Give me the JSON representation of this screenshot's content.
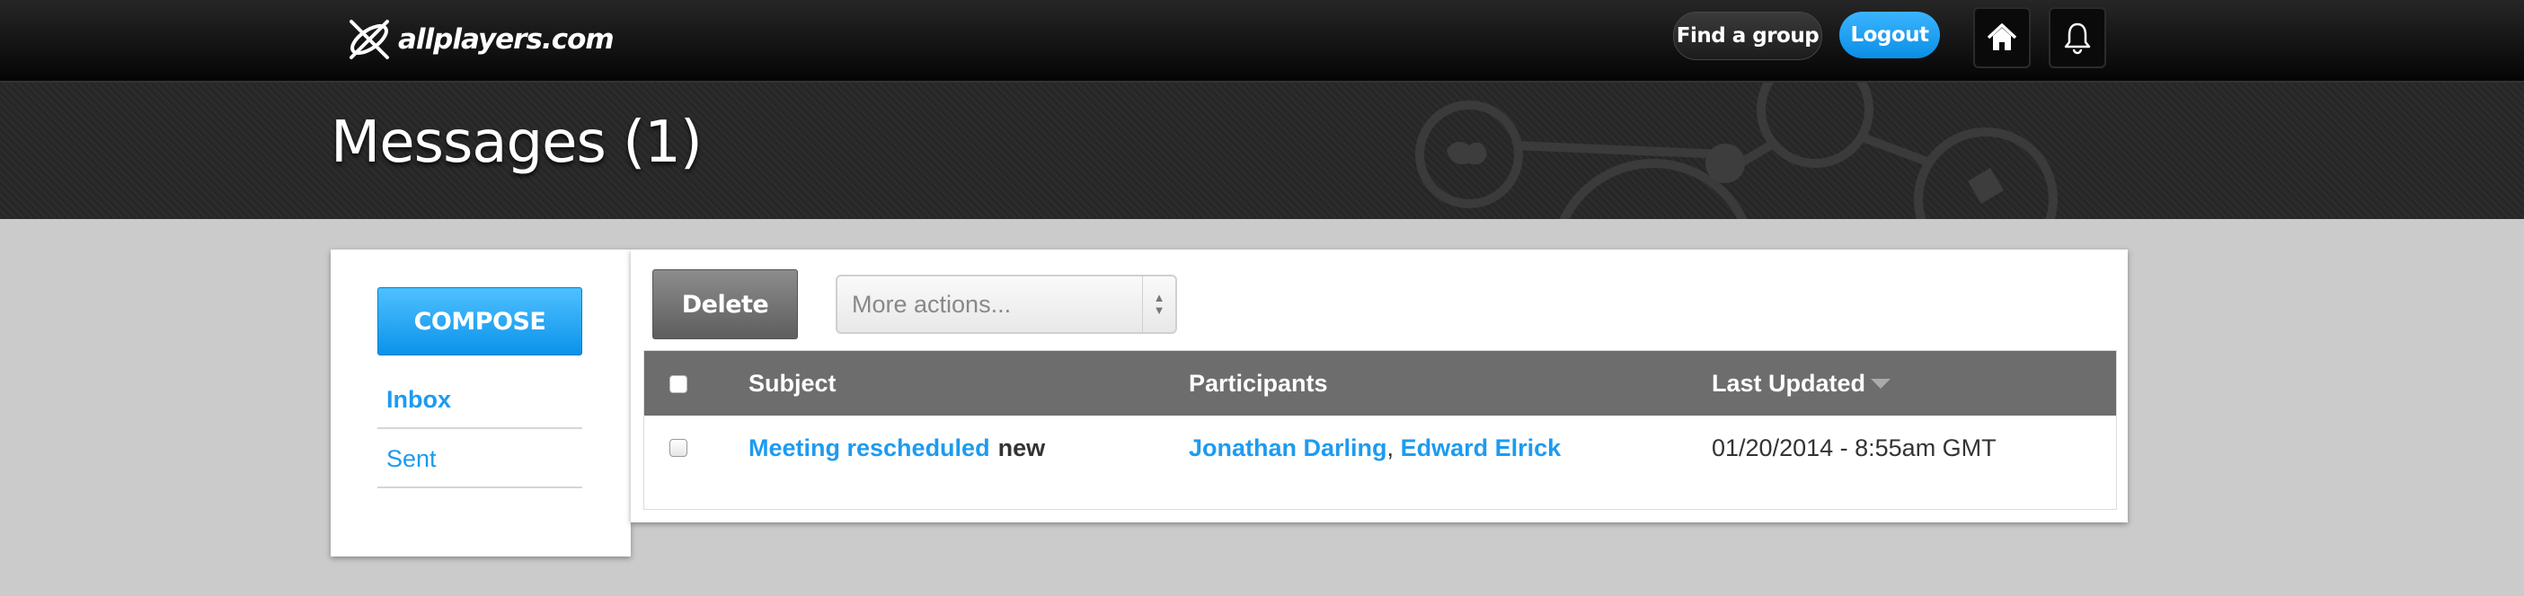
{
  "topbar": {
    "logo_text": "allplayers.com",
    "find_group_label": "Find a group",
    "logout_label": "Logout",
    "home_icon": "home-icon",
    "bell_icon": "bell-icon"
  },
  "header": {
    "title": "Messages (1)"
  },
  "sidebar": {
    "compose_label": "COMPOSE",
    "folders": [
      {
        "label": "Inbox",
        "active": true
      },
      {
        "label": "Sent",
        "active": false
      }
    ]
  },
  "toolbar": {
    "delete_label": "Delete",
    "more_actions_placeholder": "More actions..."
  },
  "table": {
    "columns": [
      "Subject",
      "Participants",
      "Last Updated"
    ],
    "sort_column": "Last Updated",
    "rows": [
      {
        "subject": "Meeting rescheduled",
        "status": "new",
        "participants": [
          "Jonathan Darling",
          "Edward Elrick"
        ],
        "participants_separator": ",",
        "last_updated": "01/20/2014 - 8:55am GMT"
      }
    ]
  },
  "colors": {
    "accent": "#1d9bf0",
    "topbar": "#0a0a0a",
    "table_header": "#6d6d6d",
    "page_bg": "#cbcbcb"
  }
}
